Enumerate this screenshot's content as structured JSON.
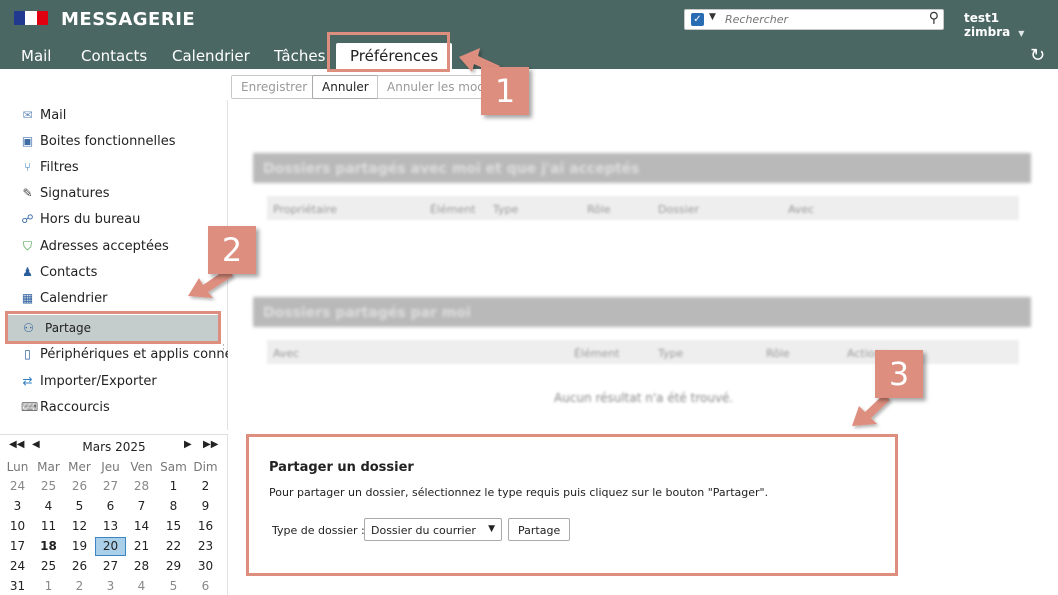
{
  "header": {
    "brand": "MESSAGERIE",
    "search_placeholder": "Rechercher",
    "user": "test1 zimbra",
    "icons": [
      "marianne-flag-logo",
      "search-type-checkbox-icon",
      "magnifier-icon",
      "refresh-icon"
    ]
  },
  "tabs": [
    {
      "label": "Mail"
    },
    {
      "label": "Contacts"
    },
    {
      "label": "Calendrier"
    },
    {
      "label": "Tâches"
    },
    {
      "label": "Préférences",
      "active": true
    }
  ],
  "toolbar": {
    "save": "Enregistrer",
    "cancel": "Annuler",
    "undo": "Annuler les modifications"
  },
  "sidebar": {
    "items": [
      {
        "label": "Mail",
        "icon": "envelope-icon"
      },
      {
        "label": "Boites fonctionnelles",
        "icon": "shared-mailbox-icon"
      },
      {
        "label": "Filtres",
        "icon": "filter-icon"
      },
      {
        "label": "Signatures",
        "icon": "pen-icon"
      },
      {
        "label": "Hors du bureau",
        "icon": "out-of-office-icon"
      },
      {
        "label": "Adresses acceptées",
        "icon": "shield-check-icon"
      },
      {
        "label": "Contacts",
        "icon": "contact-icon"
      },
      {
        "label": "Calendrier",
        "icon": "calendar-icon"
      },
      {
        "label": "Partage",
        "icon": "sharing-icon",
        "selected": true
      },
      {
        "label": "Périphériques et applis connectés",
        "icon": "mobile-device-icon"
      },
      {
        "label": "Importer/Exporter",
        "icon": "import-export-icon"
      },
      {
        "label": "Raccourcis",
        "icon": "keyboard-shortcut-icon"
      }
    ]
  },
  "calendar": {
    "month": "Mars 2025",
    "nav": {
      "prev_year": "◀◀",
      "prev_month": "◀",
      "next_month": "▶",
      "next_year": "▶▶"
    },
    "dow": [
      "Lun",
      "Mar",
      "Mer",
      "Jeu",
      "Ven",
      "Sam",
      "Dim"
    ],
    "weeks": [
      [
        "24",
        "25",
        "26",
        "27",
        "28",
        "1",
        "2"
      ],
      [
        "3",
        "4",
        "5",
        "6",
        "7",
        "8",
        "9"
      ],
      [
        "10",
        "11",
        "12",
        "13",
        "14",
        "15",
        "16"
      ],
      [
        "17",
        "18",
        "19",
        "20",
        "21",
        "22",
        "23"
      ],
      [
        "24",
        "25",
        "26",
        "27",
        "28",
        "29",
        "30"
      ],
      [
        "31",
        "1",
        "2",
        "3",
        "4",
        "5",
        "6"
      ]
    ],
    "today": "18",
    "selected": "20"
  },
  "main": {
    "accepted_section": {
      "title": "Dossiers partagés avec moi et que j'ai acceptés",
      "columns": [
        "Propriétaire",
        "Élément",
        "Type",
        "Rôle",
        "Dossier",
        "Avec"
      ]
    },
    "mine_section": {
      "title": "Dossiers partagés par moi",
      "columns": [
        "Avec",
        "Élément",
        "Type",
        "Rôle",
        "Actions"
      ],
      "empty": "Aucun résultat n'a été trouvé."
    }
  },
  "share_box": {
    "title": "Partager un dossier",
    "description": "Pour partager un dossier, sélectionnez le type requis puis cliquez sur le bouton \"Partager\".",
    "type_label": "Type de dossier :",
    "type_value": "Dossier du courrier",
    "button": "Partage"
  },
  "annotations": {
    "badge1": "1",
    "badge2": "2",
    "badge3": "3",
    "color": "#dd8e7f"
  },
  "colors": {
    "header_bg": "#4b6763",
    "selected_item_bg": "#c4cdcb",
    "calendar_selected": "#a9cfe9"
  }
}
